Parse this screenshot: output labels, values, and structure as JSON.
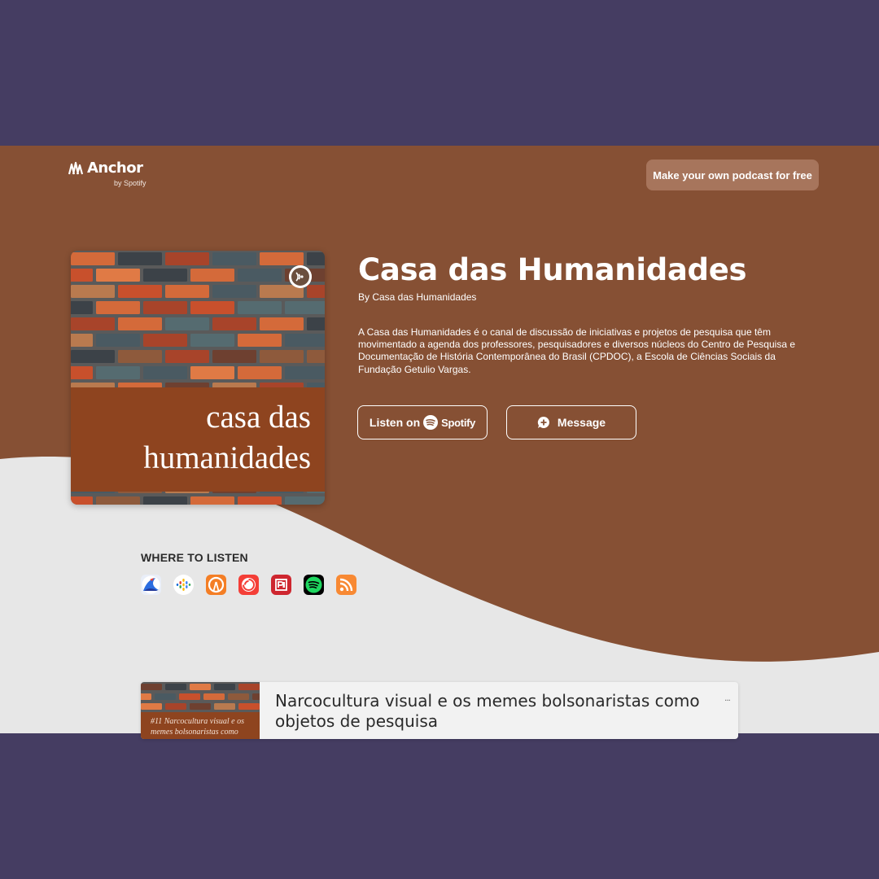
{
  "header": {
    "brand": "Anchor",
    "brand_sub": "by Spotify",
    "cta_label": "Make your own podcast for free"
  },
  "podcast": {
    "cover_title": "casa das humanidades",
    "title": "Casa das Humanidades",
    "byline": "By Casa das Humanidades",
    "description": "A Casa das Humanidades é o canal de discussão de iniciativas e projetos de pesquisa que têm movimentado a agenda dos professores, pesquisadores e diversos núcleos do Centro de Pesquisa e Documentação de História Contemporânea do Brasil (CPDOC), a Escola de Ciências Sociais da Fundação Getulio Vargas."
  },
  "actions": {
    "listen_label": "Listen on",
    "spotify_word": "Spotify",
    "message_label": "Message"
  },
  "where_to_listen": {
    "label": "WHERE TO LISTEN",
    "platforms": [
      {
        "icon": "breaker-icon"
      },
      {
        "icon": "google-podcasts-icon"
      },
      {
        "icon": "overcast-icon"
      },
      {
        "icon": "pocket-casts-icon"
      },
      {
        "icon": "radiopublic-icon"
      },
      {
        "icon": "spotify-icon"
      },
      {
        "icon": "rss-icon"
      }
    ]
  },
  "episodes": [
    {
      "title": "Narcocultura visual e os memes bolsonaristas como objetos de pesquisa",
      "thumb_text": "#11 Narcocultura visual e os memes bolsonaristas como",
      "more": "..."
    }
  ],
  "colors": {
    "outer": "#453d62",
    "brown": "#865034",
    "light_bg": "#e7e7e7",
    "cover_band": "#8e441f",
    "cta_bg": "#a7755c"
  }
}
